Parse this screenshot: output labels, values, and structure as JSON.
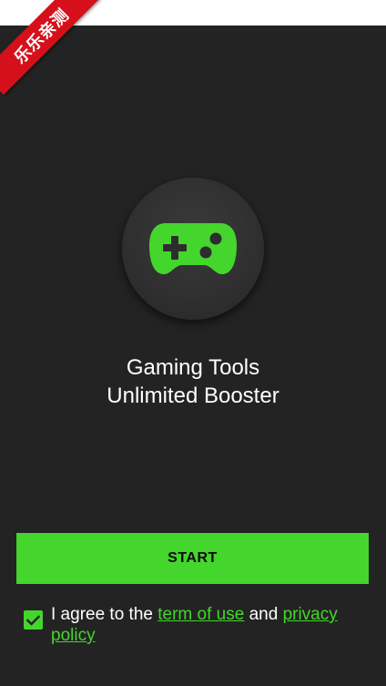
{
  "ribbon": {
    "label": "乐乐亲测"
  },
  "app": {
    "title_line1": "Gaming Tools",
    "title_line2": "Unlimited Booster",
    "icon": "gamepad-icon"
  },
  "start_button": {
    "label": "START"
  },
  "agreement": {
    "checked": true,
    "prefix": "I agree to the ",
    "terms_link": "term of use",
    "conjunction": " and ",
    "privacy_link": "privacy policy"
  },
  "colors": {
    "accent": "#44d62c",
    "background": "#232323",
    "ribbon": "#d6101a"
  }
}
